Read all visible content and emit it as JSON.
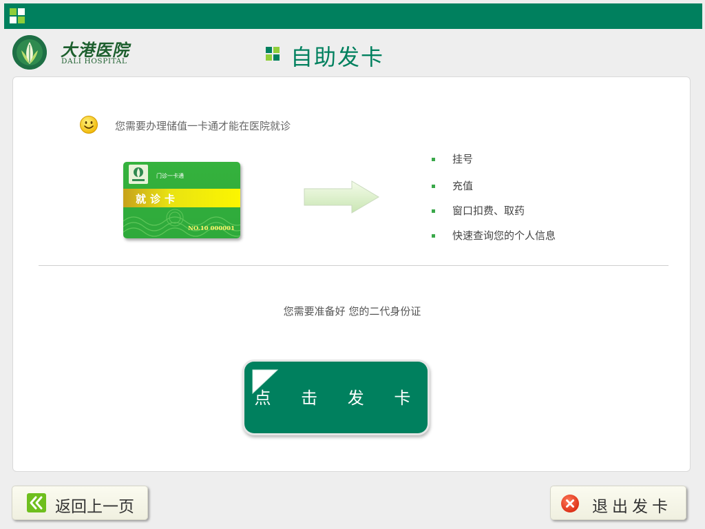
{
  "header": {
    "hospital_name_cn": "大港医院",
    "hospital_name_en": "DALI HOSPITAL",
    "page_title": "自助发卡"
  },
  "main": {
    "info_text": "您需要办理储值一卡通才能在医院就诊",
    "card": {
      "top_text": "门诊一卡通",
      "band_text": "就诊卡",
      "number": "NO.10 000001"
    },
    "features": [
      "挂号",
      "充值",
      "窗口扣费、取药",
      "快速查询您的个人信息"
    ],
    "prep_text": "您需要准备好 您的二代身份证",
    "issue_button_label": "点 击 发 卡"
  },
  "footer": {
    "back_label": "返回上一页",
    "exit_label": "退出发卡"
  },
  "colors": {
    "brand_green": "#00805e",
    "bullet_green": "#3aa84a",
    "exit_red": "#e03a1e"
  },
  "icons": {
    "title": "four-square-icon",
    "info": "smiley-icon",
    "arrow": "arrow-right-icon",
    "back": "double-chevron-left-icon",
    "exit": "close-circle-icon"
  }
}
